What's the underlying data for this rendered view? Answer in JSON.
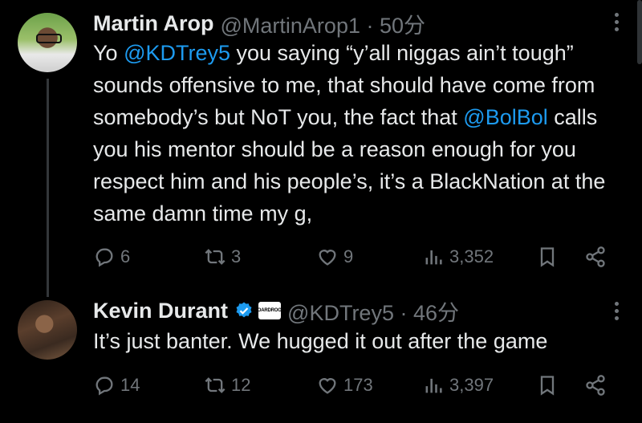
{
  "tweets": [
    {
      "name": "Martin Arop",
      "handle": "@MartinArop1",
      "time": "50分",
      "text_parts": {
        "p1": "Yo ",
        "m1": "@KDTrey5",
        "p2": " you saying “y’all niggas ain’t tough” sounds offensive to me, that should have come from somebody’s but NoT you, the fact that ",
        "m2": "@BolBol",
        "p3": " calls you his mentor should be a reason enough for you respect him and his people’s, it’s a BlackNation at the same damn time my g,"
      },
      "replies": "6",
      "reposts": "3",
      "likes": "9",
      "views": "3,352"
    },
    {
      "name": "Kevin Durant",
      "handle": "@KDTrey5",
      "time": "46分",
      "verified": true,
      "org_badge": "BOARDROOM",
      "text": "It’s just banter. We hugged it out after the game",
      "replies": "14",
      "reposts": "12",
      "likes": "173",
      "views": "3,397"
    }
  ],
  "separator": "·",
  "colors": {
    "accent": "#1d9bf0",
    "muted": "#71767b",
    "text": "#e7e9ea",
    "background": "#000000"
  },
  "icons": [
    "reply-icon",
    "repost-icon",
    "like-icon",
    "views-icon",
    "bookmark-icon",
    "share-icon",
    "more-icon",
    "verified-icon"
  ]
}
